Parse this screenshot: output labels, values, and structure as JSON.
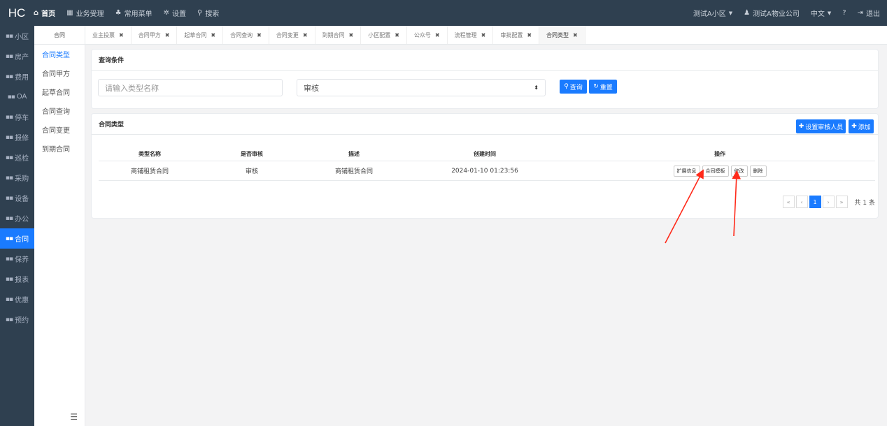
{
  "topbar": {
    "logo": "HC",
    "nav": [
      {
        "icon": "home-icon",
        "glyph": "⌂",
        "label": "首页",
        "active": true
      },
      {
        "icon": "calculator-icon",
        "glyph": "▦",
        "label": "业务受理",
        "active": false
      },
      {
        "icon": "sitemap-icon",
        "glyph": "♣",
        "label": "常用菜单",
        "active": false
      },
      {
        "icon": "gear-icon",
        "glyph": "✲",
        "label": "设置",
        "active": false
      },
      {
        "icon": "search-icon",
        "glyph": "⚲",
        "label": "搜索",
        "active": false
      }
    ],
    "community": "测试A小区",
    "company": "测试A物业公司",
    "language": "中文",
    "help_glyph": "?",
    "logout": "退出"
  },
  "sidebar": {
    "items": [
      {
        "label": "小区",
        "active": false
      },
      {
        "label": "房产",
        "active": false
      },
      {
        "label": "费用",
        "active": false
      },
      {
        "label": "OA",
        "active": false
      },
      {
        "label": "停车",
        "active": false
      },
      {
        "label": "报修",
        "active": false
      },
      {
        "label": "巡检",
        "active": false
      },
      {
        "label": "采购",
        "active": false
      },
      {
        "label": "设备",
        "active": false
      },
      {
        "label": "办公",
        "active": false
      },
      {
        "label": "合同",
        "active": true
      },
      {
        "label": "保养",
        "active": false
      },
      {
        "label": "报表",
        "active": false
      },
      {
        "label": "优惠",
        "active": false
      },
      {
        "label": "预约",
        "active": false
      }
    ]
  },
  "submenu": {
    "title": "合同",
    "items": [
      {
        "label": "合同类型",
        "active": true
      },
      {
        "label": "合同甲方",
        "active": false
      },
      {
        "label": "起草合同",
        "active": false
      },
      {
        "label": "合同查询",
        "active": false
      },
      {
        "label": "合同变更",
        "active": false
      },
      {
        "label": "到期合同",
        "active": false
      }
    ]
  },
  "tabs": [
    {
      "label": "业主投票",
      "active": false
    },
    {
      "label": "合同甲方",
      "active": false
    },
    {
      "label": "起草合同",
      "active": false
    },
    {
      "label": "合同查询",
      "active": false
    },
    {
      "label": "合同变更",
      "active": false
    },
    {
      "label": "到期合同",
      "active": false
    },
    {
      "label": "小区配置",
      "active": false
    },
    {
      "label": "公众号",
      "active": false
    },
    {
      "label": "流程管理",
      "active": false
    },
    {
      "label": "审批配置",
      "active": false
    },
    {
      "label": "合同类型",
      "active": true
    }
  ],
  "query": {
    "title": "查询条件",
    "name_placeholder": "请输入类型名称",
    "audit_value": "审核",
    "search_label": "查询",
    "reset_label": "重置"
  },
  "list": {
    "title": "合同类型",
    "set_auditor_label": "设置审核人员",
    "add_label": "添加",
    "columns": [
      "类型名称",
      "是否审核",
      "描述",
      "创建时间",
      "操作"
    ],
    "rows": [
      {
        "name": "商铺租赁合同",
        "audit": "审核",
        "desc": "商铺租赁合同",
        "created": "2024-01-10 01:23:56",
        "ops": [
          "扩展信息",
          "合同模板",
          "修改",
          "删除"
        ]
      }
    ]
  },
  "pager": {
    "first": "«",
    "prev": "‹",
    "current": "1",
    "next": "›",
    "last": "»",
    "total": "共 1 条"
  },
  "colors": {
    "primary": "#1a7bff",
    "nav_bg": "#2f4050",
    "annotation_arrow": "#ff2a1a"
  }
}
